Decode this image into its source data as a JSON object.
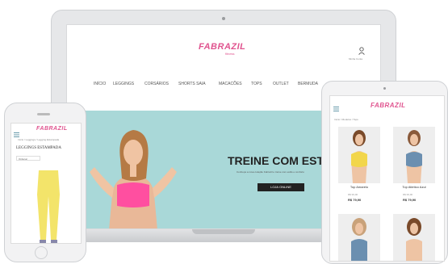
{
  "laptop": {
    "brand": "FABRAZIL",
    "brand_sub": "fitness",
    "account_label": "Minha Conta",
    "nav": [
      "INÍCIO",
      "LEGGINGS",
      "CORSÁRIOS",
      "SHORTS SAIA",
      "MACACÕES",
      "TOPS",
      "OUTLET",
      "BERMUDA"
    ],
    "hero": {
      "title": "TREINE COM ESTIL",
      "subtitle": "Conheça a nova coleção Fabrazil e treine com estilo e conforto",
      "button": "LOJA ONLINE"
    }
  },
  "phone": {
    "brand": "FABRAZIL",
    "breadcrumb": "Início / Leggings / Legging Estampada",
    "category_title": "LEGGINGS ESTAMPADA",
    "filter_label": "Ordenar"
  },
  "tablet": {
    "brand": "FABRAZIL",
    "breadcrumb": "Início / Modelos / Tops",
    "products": [
      {
        "name": "Top Amarelo",
        "old_price": "R$ 99,90",
        "price": "R$ 79,90"
      },
      {
        "name": "Top Atletico Azul",
        "old_price": "R$ 99,90",
        "price": "R$ 79,90"
      }
    ]
  },
  "colors": {
    "brand_pink": "#e0548f",
    "hero_teal": "#a9d8d8",
    "top_pink": "#ff4fa0",
    "legging_yellow": "#f3e46a",
    "top_yellow": "#f2d64b",
    "top_blue": "#6b8fb0"
  }
}
